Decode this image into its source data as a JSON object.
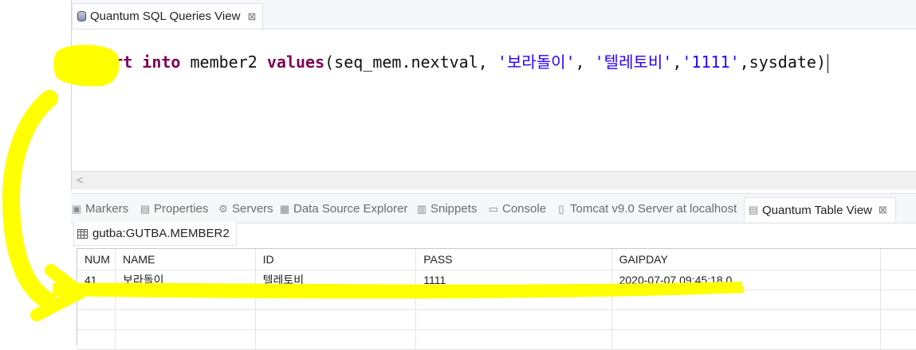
{
  "sql_view": {
    "tab_label": "Quantum SQL Queries View",
    "close_glyph": "⊠",
    "query": {
      "kw_insert": "insert",
      "kw_into": "into",
      "table": "member2",
      "kw_values": "values",
      "args_open": "(seq_mem.nextval, ",
      "str_name": "'보라돌이'",
      "comma1": ", ",
      "str_id": "'텔레토비'",
      "comma2": ",",
      "str_pass": "'1111'",
      "tail": ",sysdate)"
    }
  },
  "view_tabs": [
    {
      "label": "Markers",
      "icon": "markers-icon"
    },
    {
      "label": "Properties",
      "icon": "properties-icon"
    },
    {
      "label": "Servers",
      "icon": "servers-icon"
    },
    {
      "label": "Data Source Explorer",
      "icon": "data-source-icon"
    },
    {
      "label": "Snippets",
      "icon": "snippets-icon"
    },
    {
      "label": "Console",
      "icon": "console-icon"
    },
    {
      "label": "Tomcat v9.0 Server at localhost",
      "icon": "tomcat-icon"
    },
    {
      "label": "Quantum Table View",
      "icon": "table-view-icon",
      "active": true
    }
  ],
  "table_view": {
    "subtab_label": "gutba:GUTBA.MEMBER2",
    "columns": [
      "NUM",
      "NAME",
      "ID",
      "PASS",
      "GAIPDAY"
    ],
    "rows": [
      [
        "41",
        "보라돌이",
        "텔레토비",
        "1111",
        "2020-07-07 09:45:18.0"
      ]
    ]
  },
  "colors": {
    "keyword": "#7f0055",
    "string": "#2a00ff",
    "highlight": "#ffff00"
  }
}
